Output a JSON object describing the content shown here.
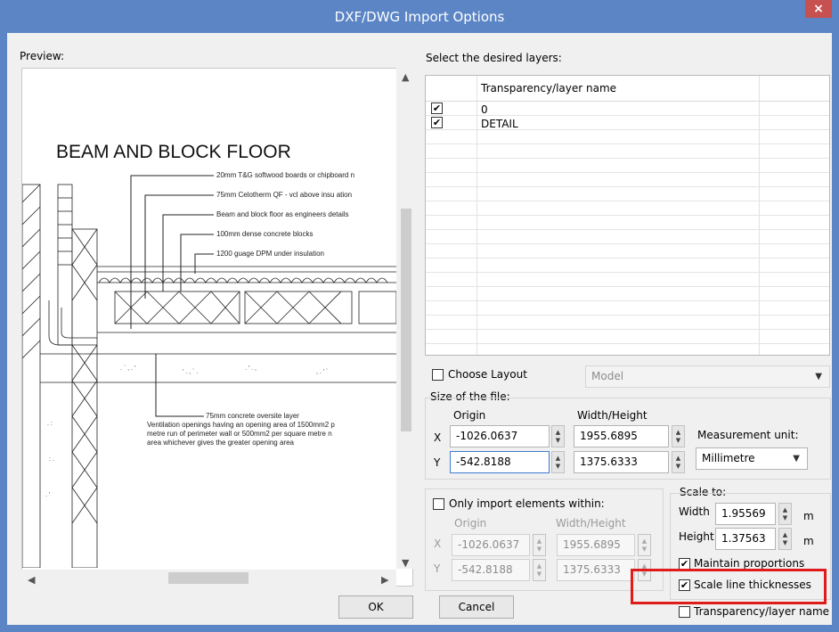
{
  "window": {
    "title": "DXF/DWG Import Options",
    "close_glyph": "×"
  },
  "preview": {
    "label": "Preview:",
    "drawing": {
      "title": "BEAM AND BLOCK FLOOR",
      "annotations": [
        "20mm T&G softwood boards or chipboard n",
        "75mm Celotherm QF - vcl above insu ation",
        "Beam and block floor as engineers details",
        "100mm dense concrete blocks",
        "1200 guage DPM under insulation"
      ],
      "notes": [
        "75mm concrete oversite layer",
        "Ventilation openings having an opening area of 1500mm2 p",
        "metre run of perimeter wall or 500mm2 per square metre n",
        "area whichever gives the greater opening area"
      ]
    }
  },
  "layers": {
    "label": "Select the desired layers:",
    "column_header": "Transparency/layer name",
    "rows": [
      {
        "name": "0",
        "checked": true,
        "mark": "✔"
      },
      {
        "name": "DETAIL",
        "checked": true,
        "mark": "✔"
      }
    ]
  },
  "choose_layout": {
    "label": "Choose Layout",
    "checked": false,
    "value": "Model"
  },
  "file_size": {
    "label": "Size of the file:",
    "origin_label": "Origin",
    "wh_label": "Width/Height",
    "x_label": "X",
    "y_label": "Y",
    "origin_x": "-1026.0637",
    "origin_y": "-542.8188",
    "width": "1955.6895",
    "height": "1375.6333",
    "measurement_label": "Measurement unit:",
    "measurement_value": "Millimetre"
  },
  "import_within": {
    "label": "Only import elements within:",
    "checked": false,
    "origin_label": "Origin",
    "wh_label": "Width/Height",
    "x_label": "X",
    "y_label": "Y",
    "origin_x": "-1026.0637",
    "origin_y": "-542.8188",
    "width": "1955.6895",
    "height": "1375.6333"
  },
  "scale_to": {
    "label": "Scale to:",
    "width_label": "Width",
    "width_value": "1.95569",
    "height_label": "Height",
    "height_value": "1.37563",
    "unit": "m",
    "maintain_label": "Maintain proportions",
    "maintain_checked": true,
    "scale_lines_label": "Scale line thicknesses",
    "scale_lines_checked": true,
    "checkmark": "✔"
  },
  "transparency_option": {
    "label": "Transparency/layer name",
    "checked": false
  },
  "buttons": {
    "ok": "OK",
    "cancel": "Cancel"
  },
  "colors": {
    "title_bar": "#5b85c5",
    "highlight": "#e01b1b",
    "close": "#c75050"
  }
}
